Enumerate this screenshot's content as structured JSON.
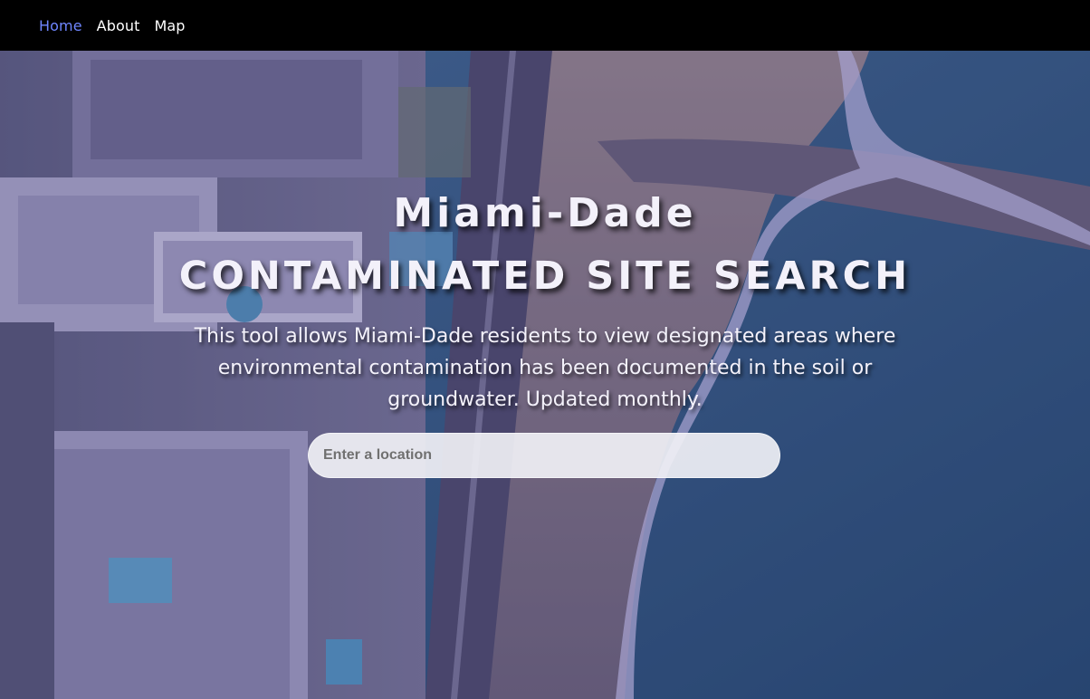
{
  "nav": {
    "items": [
      {
        "label": "Home",
        "active": true
      },
      {
        "label": "About",
        "active": false
      },
      {
        "label": "Map",
        "active": false
      }
    ],
    "active_color": "#6f86ff"
  },
  "hero": {
    "title_line1": "Miami-Dade",
    "title_line2": "CONTAMINATED SITE SEARCH",
    "description": "This tool allows Miami-Dade residents to view designated areas where environmental contamination has been documented in the soil or groundwater. Updated monthly.",
    "background": "aerial-coastline-video"
  },
  "search": {
    "placeholder": "Enter a location",
    "value": ""
  }
}
